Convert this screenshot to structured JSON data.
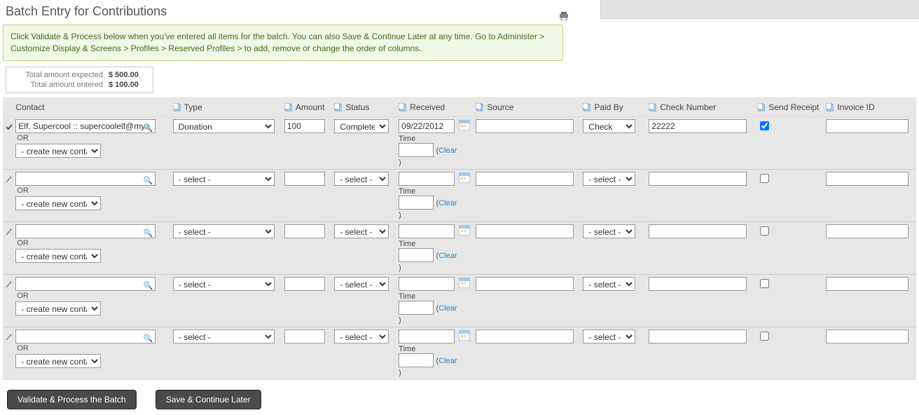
{
  "title": "Batch Entry for Contributions",
  "help_text": "Click Validate & Process below when you've entered all items for the batch. You can also Save & Continue Later at any time. Go to Administer > Customize Display & Screens > Profiles > Reserved Profiles > to add, remove or change the order of columns.",
  "totals": {
    "expected_label": "Total amount expected",
    "expected_value": "$ 500.00",
    "entered_label": "Total amount entered",
    "entered_value": "$ 100.00"
  },
  "headers": {
    "contact": "Contact",
    "type": "Type",
    "amount": "Amount",
    "status": "Status",
    "received": "Received",
    "source": "Source",
    "paid_by": "Paid By",
    "check_number": "Check Number",
    "send_receipt": "Send Receipt",
    "invoice_id": "Invoice ID"
  },
  "labels": {
    "or": "OR",
    "create_new": "- create new contact -",
    "select_placeholder": "- select -",
    "time": "Time",
    "clear": "Clear"
  },
  "rows": [
    {
      "row_status_complete": true,
      "contact": "Elf, Supercool :: supercoolelf@mya",
      "type": "Donation",
      "amount": "100",
      "status": "Completed",
      "date": "09/22/2012",
      "time": "",
      "source": "",
      "paid_by": "Check",
      "check_number": "22222",
      "send_receipt": true,
      "invoice_id": ""
    },
    {
      "row_status_complete": false,
      "contact": "",
      "type": "- select -",
      "amount": "",
      "status": "- select -",
      "date": "",
      "time": "",
      "source": "",
      "paid_by": "- select -",
      "check_number": "",
      "send_receipt": false,
      "invoice_id": ""
    },
    {
      "row_status_complete": false,
      "contact": "",
      "type": "- select -",
      "amount": "",
      "status": "- select -",
      "date": "",
      "time": "",
      "source": "",
      "paid_by": "- select -",
      "check_number": "",
      "send_receipt": false,
      "invoice_id": ""
    },
    {
      "row_status_complete": false,
      "contact": "",
      "type": "- select -",
      "amount": "",
      "status": "- select -",
      "date": "",
      "time": "",
      "source": "",
      "paid_by": "- select -",
      "check_number": "",
      "send_receipt": false,
      "invoice_id": ""
    },
    {
      "row_status_complete": false,
      "contact": "",
      "type": "- select -",
      "amount": "",
      "status": "- select -",
      "date": "",
      "time": "",
      "source": "",
      "paid_by": "- select -",
      "check_number": "",
      "send_receipt": false,
      "invoice_id": ""
    }
  ],
  "buttons": {
    "validate": "Validate & Process the Batch",
    "save": "Save & Continue Later"
  }
}
